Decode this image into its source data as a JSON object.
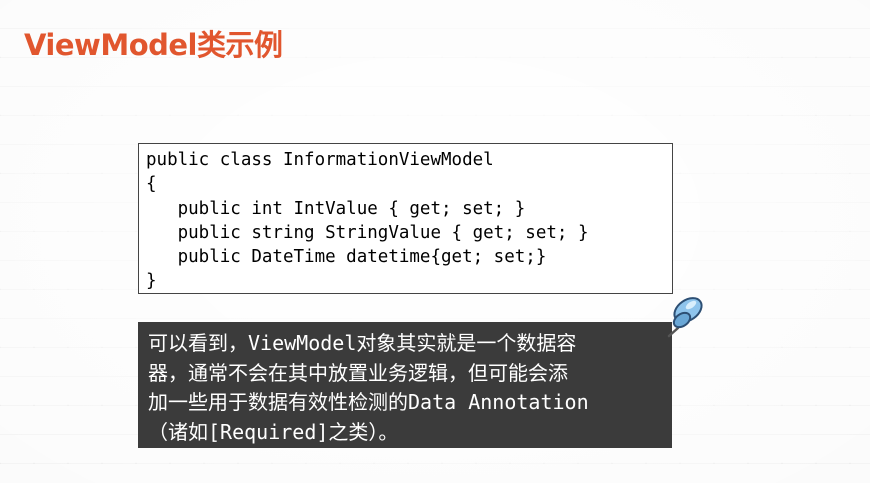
{
  "slide": {
    "title": "ViewModel类示例"
  },
  "code": {
    "lines": [
      "public class InformationViewModel",
      "{",
      "   public int IntValue { get; set; }",
      "   public string StringValue { get; set; }",
      "   public DateTime datetime{get; set;}",
      "}"
    ]
  },
  "note": {
    "lines": [
      "可以看到，ViewModel对象其实就是一个数据容",
      "器，通常不会在其中放置业务逻辑，但可能会添",
      "加一些用于数据有效性检测的Data Annotation",
      "（诸如[Required]之类）。"
    ]
  },
  "icons": {
    "pin": "pushpin-icon"
  },
  "colors": {
    "title": "#e1562e",
    "note_background": "#3b3b3b",
    "pin_head": "#8fc4ec"
  }
}
